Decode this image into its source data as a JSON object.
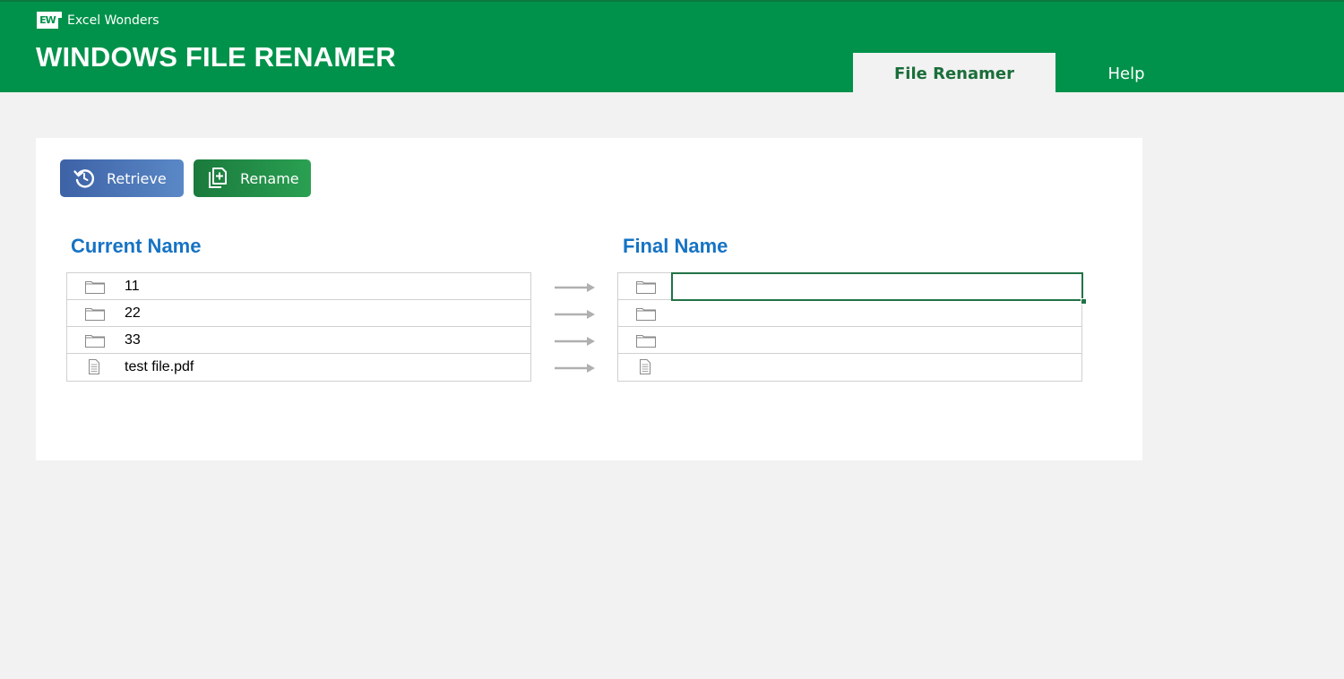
{
  "brand": {
    "logo_text": "EW",
    "name": "Excel Wonders"
  },
  "app": {
    "title": "WINDOWS FILE RENAMER"
  },
  "tabs": [
    {
      "label": "File Renamer",
      "active": true
    },
    {
      "label": "Help",
      "active": false
    }
  ],
  "toolbar": {
    "retrieve_label": "Retrieve",
    "retrieve_icon": "refresh-icon",
    "rename_label": "Rename",
    "rename_icon": "copy-add-icon"
  },
  "columns": {
    "current_header": "Current Name",
    "final_header": "Final Name"
  },
  "files": [
    {
      "type": "folder",
      "current": "11",
      "final": ""
    },
    {
      "type": "folder",
      "current": "22",
      "final": ""
    },
    {
      "type": "folder",
      "current": "33",
      "final": ""
    },
    {
      "type": "file",
      "current": "test file.pdf",
      "final": ""
    }
  ],
  "colors": {
    "brand_green": "#00924a",
    "heading_blue": "#1673c4",
    "retrieve_blue": "#4a74b8",
    "rename_green": "#218f47",
    "selection_green": "#217346"
  }
}
